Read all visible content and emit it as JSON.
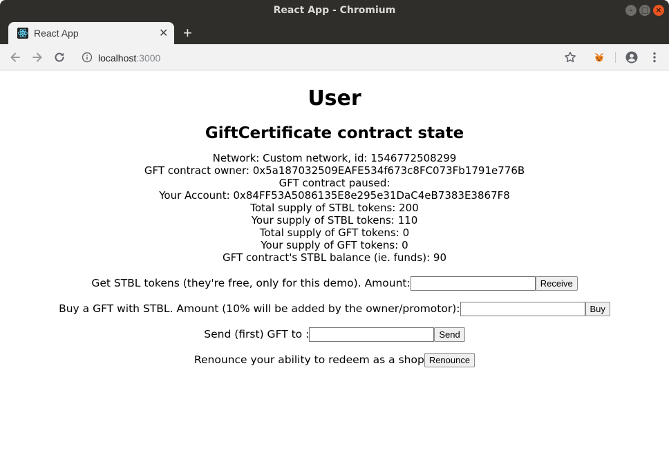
{
  "window": {
    "title": "React App - Chromium"
  },
  "tab": {
    "title": "React App",
    "close": "✕",
    "new_tab": "+"
  },
  "toolbar": {
    "url_host": "localhost",
    "url_port": ":3000"
  },
  "page": {
    "heading": "User",
    "subheading": "GiftCertificate contract state",
    "state_lines": [
      "Network: Custom network, id: 1546772508299",
      "GFT contract owner: 0x5a187032509EAFE534f673c8FC073Fb1791e776B",
      "GFT contract paused:",
      "Your Account: 0x84FF53A5086135E8e295e31DaC4eB7383E3867F8",
      "Total supply of STBL tokens: 200",
      "Your supply of STBL tokens: 110",
      "Total supply of GFT tokens: 0",
      "Your supply of GFT tokens: 0",
      "GFT contract's STBL balance (ie. funds): 90"
    ],
    "forms": {
      "get_stbl": {
        "label": "Get STBL tokens (they're free, only for this demo). Amount:",
        "value": "",
        "button": "Receive"
      },
      "buy_gft": {
        "label": "Buy a GFT with STBL. Amount (10% will be added by the owner/promotor):",
        "value": "",
        "button": "Buy"
      },
      "send_gft": {
        "label": "Send (first) GFT to :",
        "value": "",
        "button": "Send"
      },
      "renounce": {
        "label": "Renounce your ability to redeem as a shop",
        "button": "Renounce"
      }
    }
  },
  "icons": {
    "back": "back-arrow-icon",
    "forward": "forward-arrow-icon",
    "reload": "reload-icon",
    "info": "info-icon",
    "bookmark": "star-icon",
    "extension": "metamask-fox-icon",
    "profile": "account-circle-icon",
    "menu": "kebab-menu-icon"
  },
  "colors": {
    "titlebar": "#2f2e2b",
    "toolbar": "#f2f2f2",
    "close_button": "#e9541f"
  }
}
